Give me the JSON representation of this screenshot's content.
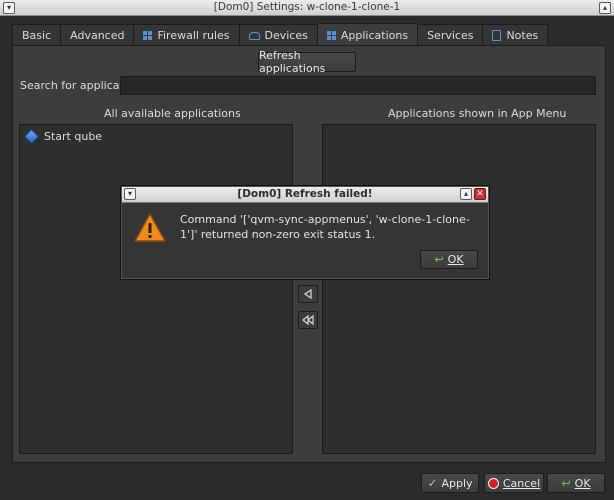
{
  "window": {
    "title": "[Dom0] Settings: w-clone-1-clone-1"
  },
  "tabs": [
    {
      "label": "Basic"
    },
    {
      "label": "Advanced"
    },
    {
      "label": "Firewall rules"
    },
    {
      "label": "Devices"
    },
    {
      "label": "Applications"
    },
    {
      "label": "Services"
    },
    {
      "label": "Notes"
    }
  ],
  "applications": {
    "refresh_label": "Refresh applications",
    "search_label": "Search for application:",
    "search_value": "",
    "available_header": "All available applications",
    "shown_header": "Applications shown in App Menu",
    "available_items": [
      {
        "label": "Start qube",
        "icon": "qube-cube-icon"
      }
    ],
    "shown_items": []
  },
  "dialog": {
    "title": "[Dom0] Refresh failed!",
    "message": "Command '['qvm-sync-appmenus', 'w-clone-1-clone-1']' returned non-zero exit status 1.",
    "ok_label": "OK",
    "icon": "warning-icon"
  },
  "footer": {
    "apply_label": "Apply",
    "cancel_label": "Cancel",
    "ok_label": "OK"
  },
  "colors": {
    "background": "#2b2b2b",
    "panel": "#3d3d3d",
    "accent": "#5b8fd6",
    "warning": "#f08a1c",
    "danger": "#d42020"
  }
}
